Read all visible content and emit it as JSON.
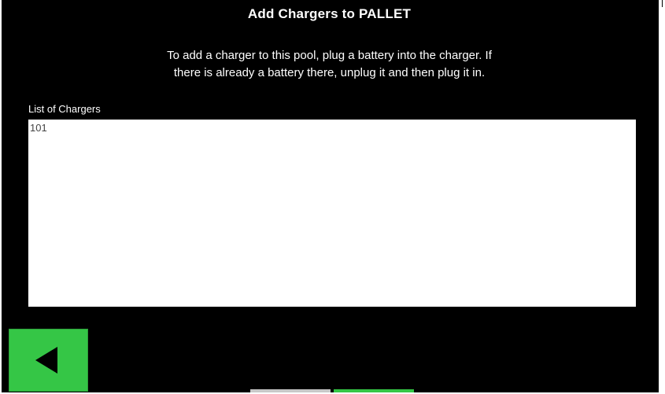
{
  "page": {
    "title": "Add Chargers to PALLET",
    "instructions": [
      "To add a charger to this pool, plug a battery into the charger. If",
      "there is already a battery there, unplug it and then plug it in."
    ]
  },
  "charger_list": {
    "label": "List of Chargers",
    "items": [
      "101"
    ]
  },
  "back_button": {
    "icon": "left-triangle-arrow-icon",
    "color": "#35c646"
  },
  "colors": {
    "background": "#000000",
    "text": "#ffffff",
    "accent_green": "#35c646",
    "list_background": "#ffffff"
  }
}
